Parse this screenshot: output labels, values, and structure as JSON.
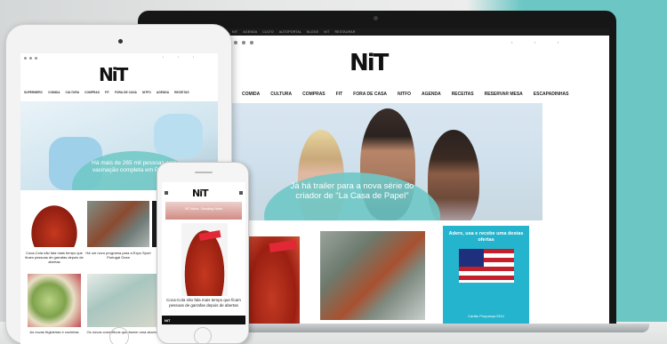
{
  "colors": {
    "accent": "#6ec8c6",
    "brand": "#111111",
    "cta_red": "#e22837",
    "ad_blue": "#24b4cd"
  },
  "laptop": {
    "topbar": [
      "NIT",
      "AGENDA",
      "CULTO",
      "AUTOPORTAL",
      "BLOGS",
      "NIT",
      "RESTAURAR"
    ],
    "logo": "NiT",
    "nav": [
      "COMIDA",
      "CULTURA",
      "COMPRAS",
      "FIT",
      "FORA DE CASA",
      "NITFo",
      "AGENDA",
      "RECEITAS",
      "RESERVAR MESA",
      "ESCAPADINHAS"
    ],
    "hero_caption": "Já há trailer para a nova série do criador de \"La Casa de Papel\"",
    "ad_text": "Adere, usa e recebe uma destas ofertas",
    "ad_footer": "Cartão Poupança EDU"
  },
  "tablet": {
    "logo": "NiT",
    "nav": [
      "SUPERMERC",
      "COMIDA",
      "CULTURA",
      "COMPRAS",
      "FIT",
      "FORA DE CASA",
      "NITFo",
      "AGENDA",
      "RECEITAS"
    ],
    "hero_caption": "Há mais de 265 mil pessoas com vacinação completa em Portugal",
    "card1": "Coca-Cola não fala mais tempo que ficam pessoas de garrafas depois de abertas",
    "card2": "Há um novo programa para a Expo Sport Portugal Ocea",
    "card3": "As novas frigideiras e cozinhas",
    "card4": "Os novos cosméticos que fazem uma alucinação"
  },
  "phone": {
    "logo": "NiT",
    "banner": "NiT Alerta - Breaking News",
    "card_text": "Coca-Cola não fala mais tempo que ficam pessoas de garrafas depois de abertas",
    "bottom_logo": "NiT"
  }
}
